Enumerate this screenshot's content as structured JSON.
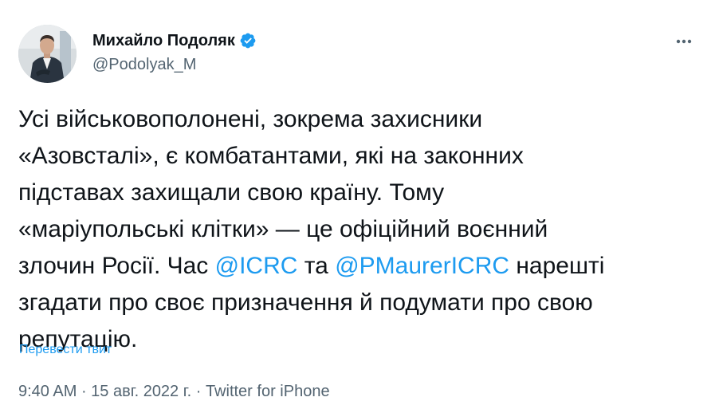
{
  "author": {
    "display_name": "Михайло Подоляк",
    "handle": "@Podolyak_M",
    "avatar_icon": "profile-photo",
    "verified_icon": "verified-badge-icon",
    "verified_color": "#1d9bf0"
  },
  "more_icon": "more-horizontal-icon",
  "tweet": {
    "line1": "Усі військовополонені, зокрема захисники",
    "line2": "«Азовсталі», є комбатантами, які на законних",
    "line3": "підставах захищали свою країну. Тому",
    "line4": "«маріупольські клітки» — це офіційний воєнний",
    "line5_pre": "злочин Росії. Час ",
    "mention1": "@ICRC",
    "line5_mid": " та ",
    "mention2": "@PMaurerICRC",
    "line5_post": " нарешті",
    "line6": "згадати про своє призначення й подумати про свою",
    "line7": "репутацію."
  },
  "translate_label": "Перевести твит",
  "meta": {
    "time": "9:40 AM",
    "separator": " · ",
    "date": "15 авг. 2022 г.",
    "source": "Twitter for iPhone"
  },
  "colors": {
    "text": "#0f1419",
    "secondary": "#536471",
    "link": "#1d9bf0"
  }
}
